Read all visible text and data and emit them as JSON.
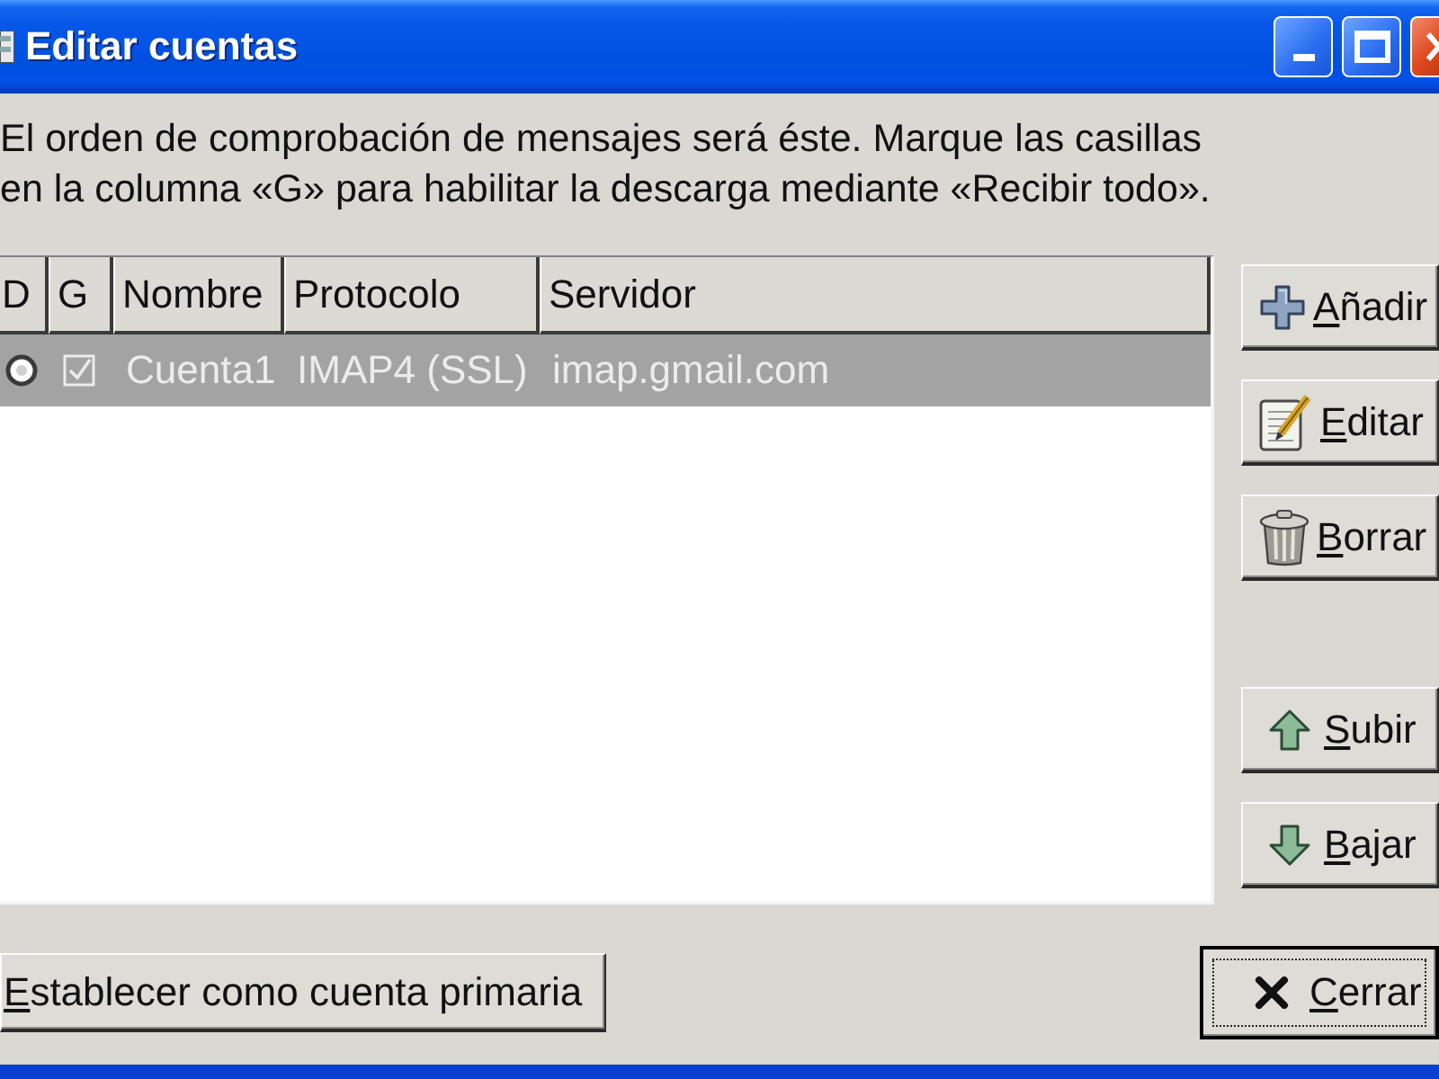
{
  "window": {
    "title": "Editar cuentas"
  },
  "description": "El orden de comprobación de mensajes será éste. Marque las casillas en la columna «G» para habilitar la descarga mediante «Recibir todo».",
  "accounts_table": {
    "columns": [
      "D",
      "G",
      "Nombre",
      "Protocolo",
      "Servidor"
    ],
    "rows": [
      {
        "selected": true,
        "default": true,
        "receive_all": true,
        "name": "Cuenta1",
        "protocol": "IMAP4 (SSL)",
        "server": "imap.gmail.com"
      }
    ]
  },
  "edit_buttons": [
    {
      "kind": "add",
      "label": "Añadir"
    },
    {
      "kind": "edit",
      "label": "Editar"
    },
    {
      "kind": "delete",
      "label": "Borrar"
    }
  ],
  "order_buttons": [
    {
      "kind": "up",
      "label": "Subir"
    },
    {
      "kind": "down",
      "label": "Bajar"
    }
  ],
  "set_primary_button": {
    "label": "Establecer como cuenta primaria"
  },
  "close_button": {
    "label": "Cerrar",
    "focused": true
  }
}
